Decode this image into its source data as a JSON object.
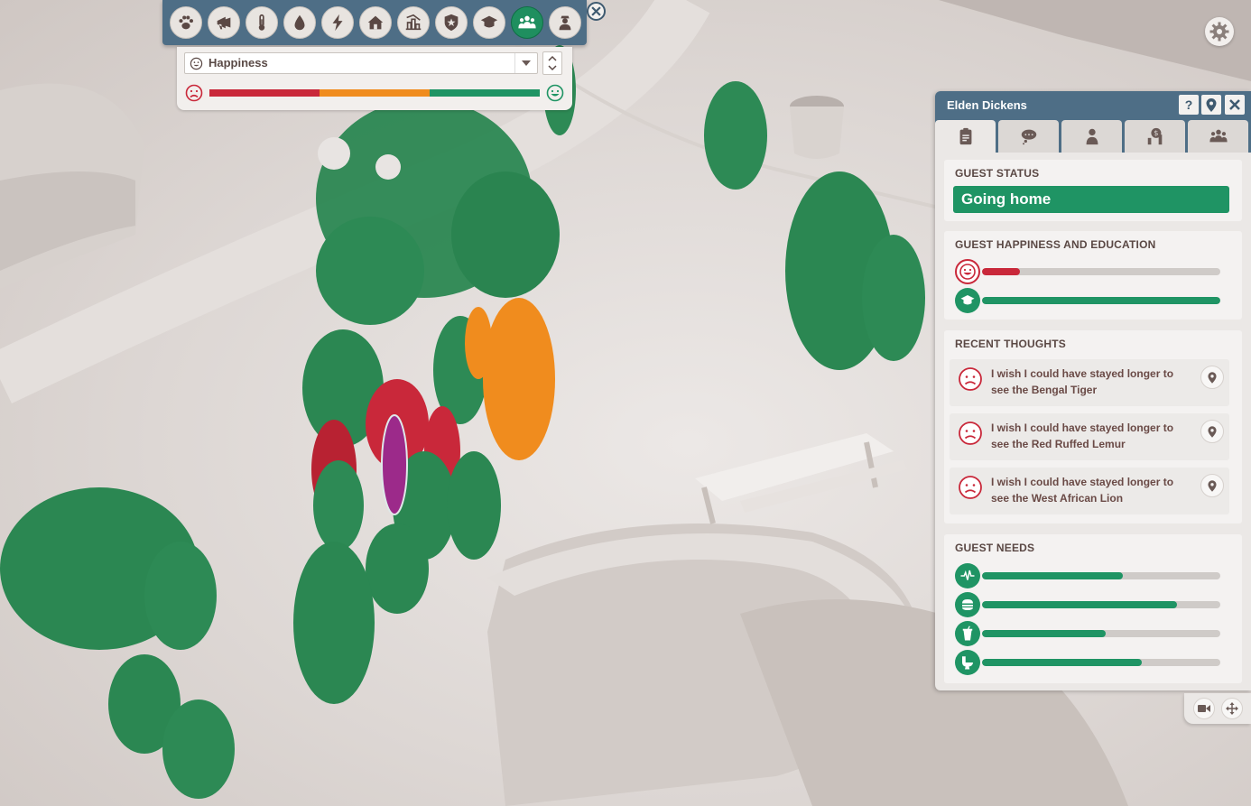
{
  "overlay": {
    "tools": [
      {
        "name": "paw-icon",
        "active": false
      },
      {
        "name": "megaphone-icon",
        "active": false
      },
      {
        "name": "thermometer-icon",
        "active": false
      },
      {
        "name": "water-drop-icon",
        "active": false
      },
      {
        "name": "lightning-icon",
        "active": false
      },
      {
        "name": "house-icon",
        "active": false
      },
      {
        "name": "chart-building-icon",
        "active": false
      },
      {
        "name": "security-badge-icon",
        "active": false
      },
      {
        "name": "graduation-cap-icon",
        "active": false
      },
      {
        "name": "guests-icon",
        "active": true
      },
      {
        "name": "staff-icon",
        "active": false
      }
    ],
    "selected_view": "Happiness",
    "legend_colors": [
      "#c9283a",
      "#f08c1e",
      "#1f9464"
    ]
  },
  "guest": {
    "name": "Elden Dickens",
    "status_title": "GUEST STATUS",
    "status": "Going home",
    "happiness_title": "GUEST HAPPINESS AND EDUCATION",
    "happiness": 0.16,
    "education": 1.0,
    "thoughts_title": "RECENT THOUGHTS",
    "thoughts": [
      {
        "line1": "I wish I could have stayed longer to",
        "line2": "see the Bengal Tiger"
      },
      {
        "line1": "I wish I could have stayed longer to",
        "line2": "see the Red Ruffed Lemur"
      },
      {
        "line1": "I wish I could have stayed longer to",
        "line2": "see the West African Lion"
      }
    ],
    "needs_title": "GUEST NEEDS",
    "needs": [
      {
        "icon": "heartbeat-icon",
        "value": 0.59
      },
      {
        "icon": "burger-icon",
        "value": 0.82
      },
      {
        "icon": "drink-icon",
        "value": 0.52
      },
      {
        "icon": "toilet-icon",
        "value": 0.67
      }
    ]
  },
  "colors": {
    "header": "#4e6e86",
    "good": "#1f9464",
    "bad": "#c9283a",
    "warn": "#f08c1e"
  }
}
